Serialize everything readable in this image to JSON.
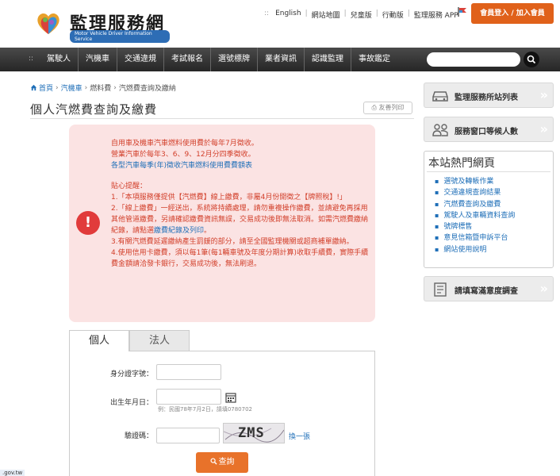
{
  "header": {
    "logo_title": "監理服務網",
    "logo_subtitle": "Motor Vehicle Driver Information Service",
    "top_links_lead": "::",
    "top_links": [
      "English",
      "網站地圖",
      "兒童版",
      "行動版",
      "監理服務 APP"
    ],
    "login_label": "會員登入 / 加入會員"
  },
  "nav": {
    "lead": "::",
    "items": [
      "駕駛人",
      "汽機車",
      "交通違規",
      "考試報名",
      "選號標牌",
      "業者資訊",
      "認識監理",
      "事故鑑定"
    ],
    "search_placeholder": ""
  },
  "breadcrumb": {
    "home": "首頁",
    "items": [
      "汽機車",
      "燃料費",
      "汽燃費查詢及繳納"
    ]
  },
  "page": {
    "title": "個人汽燃費查詢及繳費",
    "print_label": "友善列印"
  },
  "notice": {
    "line1": "自用車及機車汽車燃料使用費於每年7月徵收。",
    "line2": "營業汽車於每年3、6、9、12月分四季徵收。",
    "link1": "各型汽車每季(年)徵收汽車燃料使用費費額表",
    "heading": "貼心提醒：",
    "item1": "1.「本項服務僅提供【汽燃費】線上繳費，非屬4月份開徵之【牌照稅】!」",
    "item2a": "2.「線上繳費」一經送出，系統將持續處理，請勿重複操作繳費，並請避免再採用其他管道繳費，另請確認繳費資訊無誤，交易成功後即無法取消。如需汽燃費繳納紀錄，請點選",
    "item2_link": "繳費紀錄及列印",
    "item2b": "。",
    "item3": "3.有關汽燃費延遲繳納產生罰鍰的部分，請至全國監理機關或超商補單繳納。",
    "item4": "4.使用信用卡繳費，須以每1筆(每1輛車號及年度分期計算)收取手續費，實際手續費金額請洽發卡銀行，交易成功後，無法刷退。"
  },
  "tabs": {
    "personal": "個人",
    "corporate": "法人"
  },
  "form": {
    "id_label": "身分證字號：",
    "birth_label": "出生年月日：",
    "birth_hint": "例：民國78年7月2日，請填0780702",
    "captcha_label": "驗證碼：",
    "captcha_text": "ZMS",
    "refresh_label": "換一張",
    "submit_label": "查詢"
  },
  "sidebar": {
    "btn1": "監理服務所站列表",
    "btn2": "服務窗口等候人數",
    "hot_title": "本站熱門網頁",
    "hot_items": [
      "選號及轉帳作業",
      "交通違規查詢結果",
      "汽燃費查詢及繳費",
      "駕駛人及車輛資料查詢",
      "號牌標售",
      "意見信箱暨申訴平台",
      "網站使用說明"
    ],
    "btn3": "請填寫滿意度調查"
  },
  "edge_tag": ".gov.tw",
  "colors": {
    "accent_orange": "#e8722a",
    "nav_dark": "#2f2f2f",
    "notice_bg": "#fbe3e3",
    "notice_text": "#d23f2a",
    "link_blue": "#1f6fb8"
  }
}
